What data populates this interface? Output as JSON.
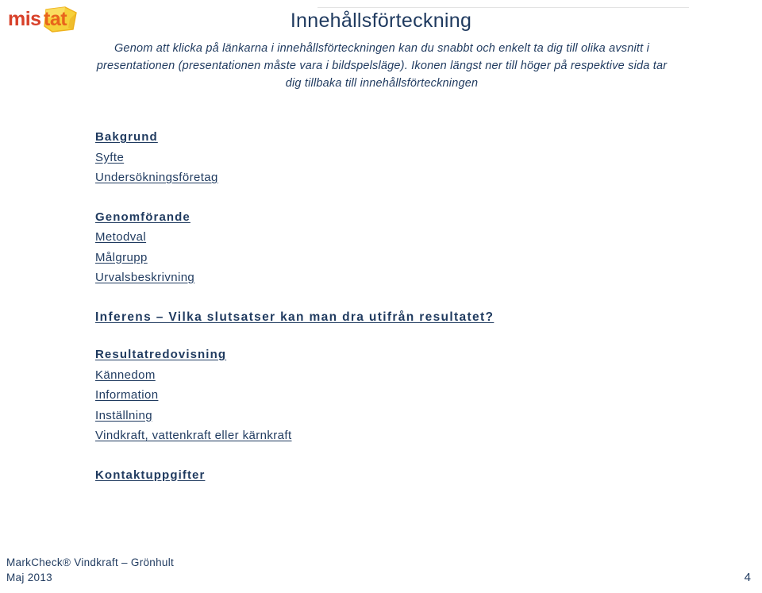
{
  "brand": {
    "logo_text": "mistat",
    "logo_part_1": "mis",
    "logo_part_2": "tat",
    "colors": {
      "logo_red": "#d8412a",
      "logo_orange": "#e8641c",
      "logo_yellow": "#f5c518",
      "logo_gold": "#f0a81e",
      "text_navy": "#1f3a5f",
      "rule_gray": "#e3e3e3"
    }
  },
  "slide": {
    "title": "Innehållsförteckning",
    "intro": "Genom att klicka på länkarna i innehållsförteckningen kan du snabbt och enkelt ta dig till olika avsnitt i presentationen (presentationen måste vara i bildspelsläge). Ikonen längst ner till höger på respektive sida tar dig tillbaka till innehållsförteckningen"
  },
  "toc": {
    "groups": [
      {
        "items": [
          {
            "label": "Bakgrund",
            "style": "heading"
          },
          {
            "label": "Syfte",
            "style": "item"
          },
          {
            "label": "Undersökningsföretag",
            "style": "item"
          }
        ]
      },
      {
        "items": [
          {
            "label": "Genomförande",
            "style": "heading"
          },
          {
            "label": "Metodval",
            "style": "item"
          },
          {
            "label": "Målgrupp",
            "style": "item"
          },
          {
            "label": "Urvalsbeskrivning",
            "style": "item"
          }
        ]
      },
      {
        "items": [
          {
            "label": "Inferens – Vilka slutsatser kan man dra utifrån resultatet?",
            "style": "big-heading"
          }
        ]
      },
      {
        "items": [
          {
            "label": "Resultatredovisning",
            "style": "heading"
          },
          {
            "label": "Kännedom",
            "style": "item"
          },
          {
            "label": "Information",
            "style": "item"
          },
          {
            "label": "Inställning",
            "style": "item"
          },
          {
            "label": "Vindkraft, vattenkraft eller kärnkraft",
            "style": "item"
          }
        ]
      },
      {
        "items": [
          {
            "label": "Kontaktuppgifter ",
            "style": "heading"
          }
        ]
      }
    ]
  },
  "footer": {
    "line1": "MarkCheck® Vindkraft – Grönhult",
    "line2": "Maj 2013",
    "page_number": "4"
  }
}
